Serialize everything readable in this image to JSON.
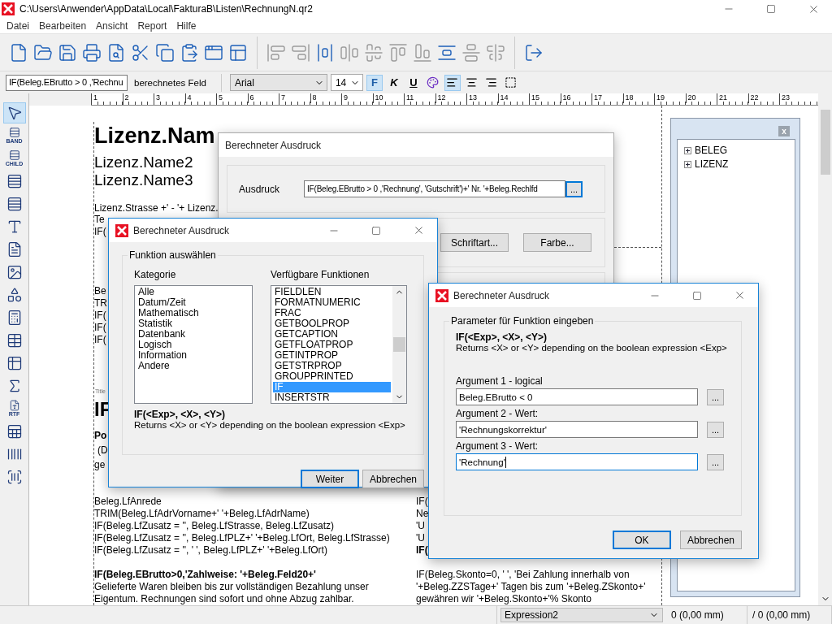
{
  "window": {
    "title": "C:\\Users\\Anwender\\AppData\\Local\\FakturaB\\Listen\\RechnungN.qr2"
  },
  "menu": [
    "Datei",
    "Bearbeiten",
    "Ansicht",
    "Report",
    "Hilfe"
  ],
  "toolbar": [
    {
      "disabled": false
    },
    {
      "disabled": false
    },
    {
      "disabled": false
    },
    {
      "disabled": false
    },
    {
      "disabled": false
    },
    {
      "disabled": false
    },
    {
      "disabled": false
    },
    {
      "disabled": false
    },
    {
      "disabled": false
    },
    {
      "disabled": false
    },
    {
      "disabled": true
    },
    {
      "disabled": true
    },
    {
      "disabled": false
    },
    {
      "disabled": true
    },
    {
      "disabled": true
    },
    {
      "disabled": true
    },
    {
      "disabled": true
    },
    {
      "disabled": false
    },
    {
      "disabled": true
    },
    {
      "disabled": true
    },
    {
      "disabled": false
    }
  ],
  "format_bar": {
    "expression": "IF(Beleg.EBrutto > 0 ,'Rechnu",
    "field_type": "berechnetes Feld",
    "font": "Arial",
    "size": "14",
    "styles": [
      {
        "label": "F",
        "selected": true
      },
      {
        "label": "K",
        "selected": false
      },
      {
        "label": "U",
        "selected": false
      }
    ],
    "alignments": [
      {
        "selected": true
      },
      {
        "selected": false
      },
      {
        "selected": false
      }
    ]
  },
  "palette": [
    {
      "selected": true
    },
    {
      "label": "BAND",
      "selected": false
    },
    {
      "label": "CHILD",
      "selected": false
    },
    {
      "selected": false
    },
    {
      "selected": false
    },
    {
      "selected": false
    },
    {
      "selected": false
    },
    {
      "selected": false
    },
    {
      "selected": false
    },
    {
      "selected": false
    },
    {
      "selected": false
    },
    {
      "selected": false
    },
    {
      "selected": false
    },
    {
      "label": "RTF",
      "selected": false
    },
    {
      "selected": false
    },
    {
      "selected": false
    },
    {
      "selected": false
    }
  ],
  "ruler": [
    "1",
    "2",
    "3",
    "4",
    "5",
    "6",
    "7",
    "8",
    "9",
    "10",
    "11",
    "12",
    "13",
    "14",
    "15",
    "16",
    "17",
    "18",
    "19",
    "20",
    "21",
    "22",
    "23"
  ],
  "canvas": {
    "texts": [
      {
        "kind": "title",
        "text": "Lizenz.Nam"
      },
      {
        "kind": "large",
        "text": "Lizenz.Name2"
      },
      {
        "kind": "large",
        "text": "Lizenz.Name3"
      },
      {
        "kind": "normal",
        "text": "Lizenz.Strasse +' - '+ Lizenz."
      },
      {
        "kind": "normal",
        "text": "Te"
      },
      {
        "kind": "normal",
        "text": "IF("
      },
      {
        "kind": "normal",
        "text": "Be"
      },
      {
        "kind": "normal",
        "text": "TR"
      },
      {
        "kind": "normal",
        "text": "IF("
      },
      {
        "kind": "normal",
        "text": "IF("
      },
      {
        "kind": "normal",
        "text": "IF("
      },
      {
        "kind": "small",
        "text": "Title"
      },
      {
        "kind": "heading",
        "text": "IF"
      },
      {
        "kind": "bold",
        "text": "Po"
      },
      {
        "kind": "normal",
        "text": "(D"
      },
      {
        "kind": "normal",
        "text": "ge"
      },
      {
        "kind": "normal",
        "text": "Beleg.LfAnrede"
      },
      {
        "kind": "normal",
        "text": "TRIM(Beleg.LfAdrVorname+' '+Beleg.LfAdrName)"
      },
      {
        "kind": "normal",
        "text": "IF(Beleg.LfZusatz = '', Beleg.LfStrasse, Beleg.LfZusatz)"
      },
      {
        "kind": "normal",
        "text": "IF(Beleg.LfZusatz = '', Beleg.LfPLZ+' '+Beleg.LfOrt, Beleg.LfStrasse)"
      },
      {
        "kind": "normal",
        "text": "IF(Beleg.LfZusatz = '', ' ', Beleg.LfPLZ+' '+Beleg.LfOrt)"
      },
      {
        "kind": "bold",
        "text": "IF(Beleg.EBrutto>0,'Zahlweise: '+Beleg.Feld20+'"
      },
      {
        "kind": "normal",
        "text": "Gelieferte Waren bleiben bis zur vollständigen Bezahlung unser"
      },
      {
        "kind": "normal",
        "text": "Eigentum. Rechnungen sind sofort und ohne Abzug zahlbar."
      },
      {
        "kind": "normal",
        "text": "IF("
      },
      {
        "kind": "normal",
        "text": "Ne"
      },
      {
        "kind": "normal",
        "text": "'U"
      },
      {
        "kind": "normal",
        "text": "'U"
      },
      {
        "kind": "bold",
        "text": "IF("
      },
      {
        "kind": "normal",
        "text": "IF(Beleg.Skonto=0, ' ', 'Bei Zahlung innerhalb von"
      },
      {
        "kind": "normal",
        "text": "'+Beleg.ZZSTage+' Tagen bis zum '+Beleg.ZSkonto+'"
      },
      {
        "kind": "normal",
        "text": "gewähren wir '+Beleg.Skonto+'% Skonto"
      }
    ]
  },
  "field_panel": {
    "close": "x",
    "tree": [
      {
        "label": "BELEG",
        "expanded": false
      },
      {
        "label": "LIZENZ",
        "expanded": false
      }
    ]
  },
  "expression_dialog": {
    "title": "Berechneter Ausdruck",
    "label": "Ausdruck",
    "value": "IF(Beleg.EBrutto > 0 ,'Rechnung', 'Gutschrift')+' Nr. '+Beleg.Rechlfd",
    "browse": "...",
    "buttons": [
      "Schriftart...",
      "Farbe..."
    ]
  },
  "function_dialog": {
    "title": "Berechneter Ausdruck",
    "group": "Funktion auswählen",
    "category_label": "Kategorie",
    "categories": [
      {
        "label": "Alle",
        "selected": false
      },
      {
        "label": "Datum/Zeit",
        "selected": false
      },
      {
        "label": "Mathematisch",
        "selected": false
      },
      {
        "label": "Statistik",
        "selected": false
      },
      {
        "label": "Datenbank",
        "selected": false
      },
      {
        "label": "Logisch",
        "selected": false
      },
      {
        "label": "Information",
        "selected": false
      },
      {
        "label": "Andere",
        "selected": false
      }
    ],
    "functions_label": "Verfügbare Funktionen",
    "functions": [
      {
        "label": "FIELDLEN",
        "selected": false
      },
      {
        "label": "FORMATNUMERIC",
        "selected": false
      },
      {
        "label": "FRAC",
        "selected": false
      },
      {
        "label": "GETBOOLPROP",
        "selected": false
      },
      {
        "label": "GETCAPTION",
        "selected": false
      },
      {
        "label": "GETFLOATPROP",
        "selected": false
      },
      {
        "label": "GETINTPROP",
        "selected": false
      },
      {
        "label": "GETSTRPROP",
        "selected": false
      },
      {
        "label": "GROUPPRINTED",
        "selected": false
      },
      {
        "label": "IF",
        "selected": true
      },
      {
        "label": "INSERTSTR",
        "selected": false
      }
    ],
    "signature": "IF(<Exp>, <X>, <Y>)",
    "description": "Returns <X> or <Y> depending on the boolean expression <Exp>",
    "buttons": [
      {
        "label": "Weiter",
        "default": true
      },
      {
        "label": "Abbrechen",
        "default": false
      }
    ]
  },
  "parameter_dialog": {
    "title": "Berechneter Ausdruck",
    "group": "Parameter für Funktion eingeben",
    "signature": "IF(<Exp>, <X>, <Y>)",
    "description": "Returns <X> or <Y> depending on the boolean expression <Exp>",
    "arguments": [
      {
        "label": "Argument 1 - logical",
        "value": "Beleg.EBrutto < 0",
        "browse": "...",
        "focused": false
      },
      {
        "label": "Argument 2 - Wert:",
        "value": "'Rechnungskorrektur'",
        "browse": "...",
        "focused": false
      },
      {
        "label": "Argument 3 - Wert:",
        "value": "'Rechnung'",
        "browse": "...",
        "focused": true
      }
    ],
    "buttons": [
      {
        "label": "OK",
        "default": true
      },
      {
        "label": "Abbrechen",
        "default": false
      }
    ]
  },
  "status_bar": {
    "expression": "Expression2",
    "x": "0 (0,00 mm)",
    "y": "/ 0 (0,00 mm)"
  }
}
